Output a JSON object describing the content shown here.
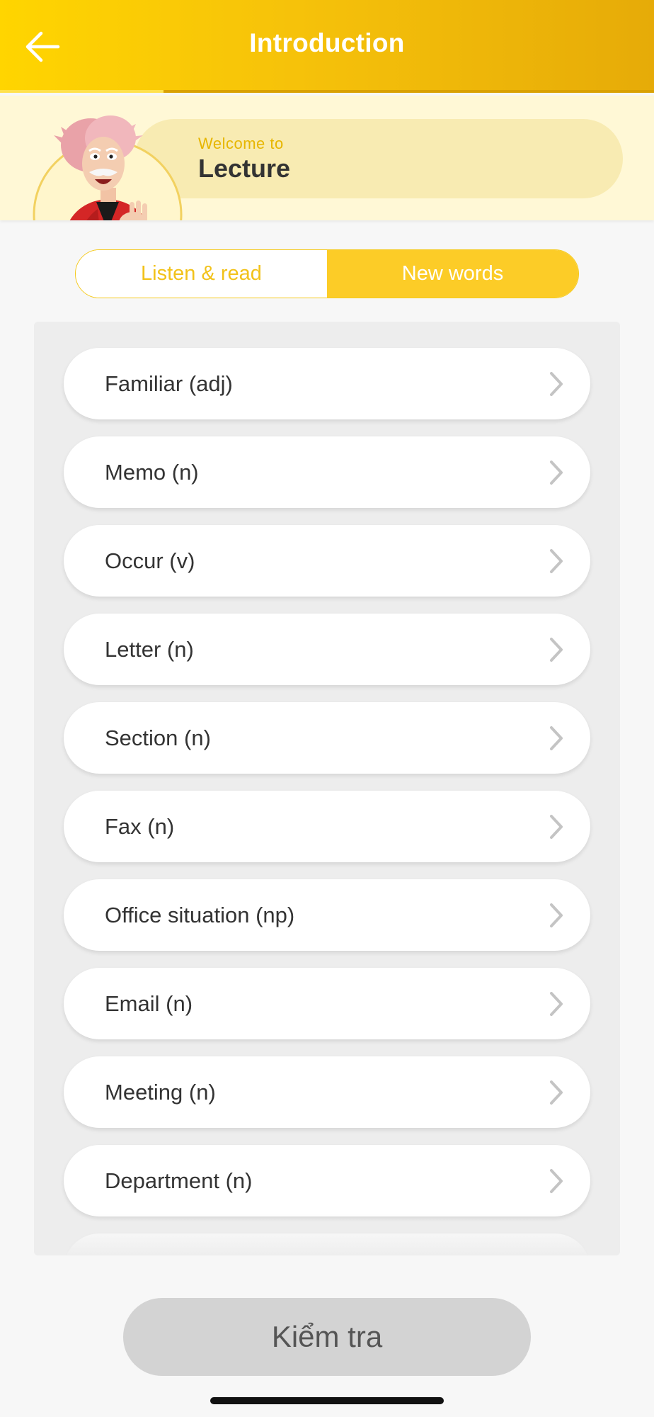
{
  "header": {
    "title": "Introduction",
    "back_icon": "arrow-left-icon",
    "gradient": [
      "#ffd500",
      "#e6ab08"
    ]
  },
  "welcome": {
    "subtitle": "Welcome to",
    "title": "Lecture",
    "avatar": "cartoon-professor-avatar"
  },
  "tabs": [
    {
      "label": "Listen & read",
      "active": false
    },
    {
      "label": "New words",
      "active": true
    }
  ],
  "words": [
    "Familiar (adj)",
    "Memo (n)",
    "Occur (v)",
    "Letter (n)",
    "Section (n)",
    "Fax (n)",
    "Office situation (np)",
    "Email (n)",
    "Meeting (n)",
    "Department (n)"
  ],
  "word_icon": "chevron-right-icon",
  "footer": {
    "check_label": "Kiểm tra"
  },
  "colors": {
    "accent": "#fccc27",
    "accent_text": "#f2c21a",
    "banner_bg": "#fff8d6",
    "button_disabled": "#d3d3d3"
  }
}
